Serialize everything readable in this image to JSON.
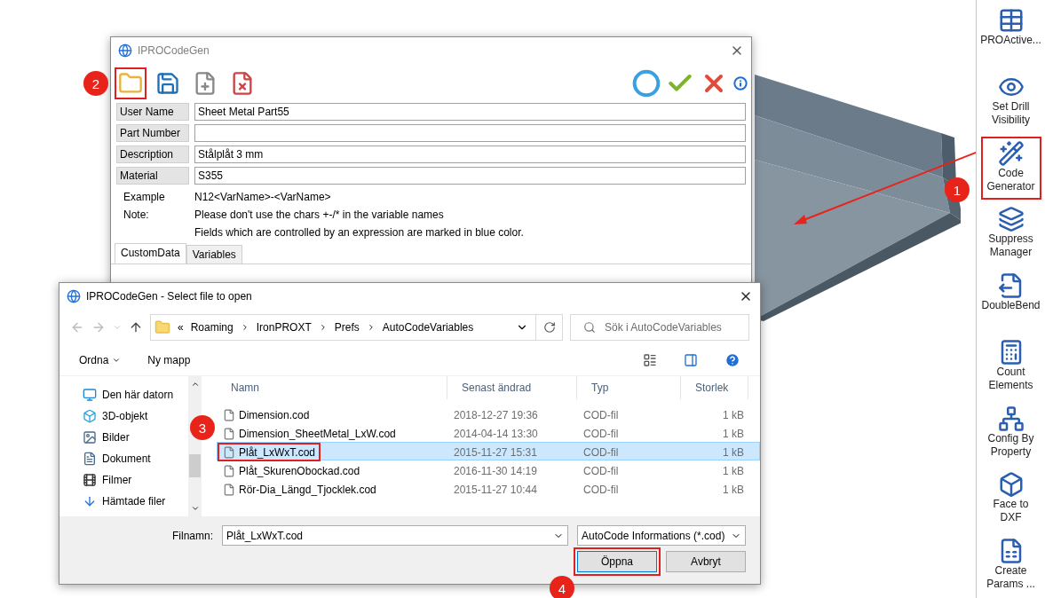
{
  "main_window": {
    "title": "IPROCodeGen",
    "toolbar": [
      {
        "kind": "open",
        "highlighted": true
      },
      {
        "kind": "save",
        "highlighted": false
      },
      {
        "kind": "new",
        "highlighted": false
      },
      {
        "kind": "delete",
        "highlighted": false
      }
    ],
    "actions": [
      {
        "kind": "stop"
      },
      {
        "kind": "ok"
      },
      {
        "kind": "cancel"
      },
      {
        "kind": "info"
      }
    ],
    "fields": [
      {
        "label": "User Name",
        "value": "Sheet Metal Part55"
      },
      {
        "label": "Part Number"
      },
      {
        "label": "Description",
        "value": "Stålplåt 3 mm"
      },
      {
        "label": "Material",
        "value": "S355"
      }
    ],
    "example": {
      "label": "Example",
      "text": "N12<VarName>-<VarName>"
    },
    "note": {
      "label": "Note:",
      "lines": [
        "Please don't use the chars +-/* in the variable names",
        "Fields which are controlled by an expression are marked in blue color."
      ]
    },
    "tabs": [
      {
        "label": "CustomData",
        "selected": true
      },
      {
        "label": "Variables",
        "selected": false
      }
    ]
  },
  "file_dialog": {
    "title": "IPROCodeGen - Select file to open",
    "path_prefix": "«",
    "path": [
      "Roaming",
      "IronPROXT",
      "Prefs",
      "AutoCodeVariables"
    ],
    "search": {
      "placeholder": "Sök i AutoCodeVariables"
    },
    "organize": "Ordna",
    "new_folder": "Ny mapp",
    "sidebar": [
      {
        "label": "Den här datorn",
        "kind": "computer"
      },
      {
        "label": "3D-objekt",
        "kind": "cube"
      },
      {
        "label": "Bilder",
        "kind": "pictures"
      },
      {
        "label": "Dokument",
        "kind": "document"
      },
      {
        "label": "Filmer",
        "kind": "film"
      },
      {
        "label": "Hämtade filer",
        "kind": "download"
      }
    ],
    "columns": [
      "Namn",
      "Senast ändrad",
      "Typ",
      "Storlek"
    ],
    "rows": [
      {
        "name": "Dimension.cod",
        "modified": "2018-12-27 19:36",
        "type": "COD-fil",
        "size": "1 kB",
        "selected": false,
        "highlighted": false
      },
      {
        "name": "Dimension_SheetMetal_LxW.cod",
        "modified": "2014-04-14 13:30",
        "type": "COD-fil",
        "size": "1 kB",
        "selected": false,
        "highlighted": false
      },
      {
        "name": "Plåt_LxWxT.cod",
        "modified": "2015-11-27 15:31",
        "type": "COD-fil",
        "size": "1 kB",
        "selected": true,
        "highlighted": true
      },
      {
        "name": "Plåt_SkurenObockad.cod",
        "modified": "2016-11-30 14:19",
        "type": "COD-fil",
        "size": "1 kB",
        "selected": false,
        "highlighted": false
      },
      {
        "name": "Rör-Dia_Längd_Tjocklek.cod",
        "modified": "2015-11-27 10:44",
        "type": "COD-fil",
        "size": "1 kB",
        "selected": false,
        "highlighted": false
      }
    ],
    "filename_label": "Filnamn:",
    "filename": "Plåt_LxWxT.cod",
    "filter": "AutoCode Informations (*.cod)",
    "buttons": [
      {
        "label": "Öppna",
        "highlighted": true
      },
      {
        "label": "Avbryt",
        "highlighted": false
      }
    ]
  },
  "ribbon": [
    {
      "label": "PROActive...",
      "highlighted": false
    },
    {
      "label": "Set Drill Visibility",
      "highlighted": false
    },
    {
      "label": "Code Generator",
      "highlighted": true
    },
    {
      "label": "Suppress Manager",
      "highlighted": false
    },
    {
      "label": "DoubleBend",
      "highlighted": false
    },
    {
      "label": "Count Elements",
      "highlighted": false
    },
    {
      "label": "Config By Property",
      "highlighted": false
    },
    {
      "label": "Face to DXF",
      "highlighted": false
    },
    {
      "label": "Create Params ...",
      "highlighted": false
    }
  ],
  "callouts": [
    "1",
    "2",
    "3",
    "4"
  ]
}
